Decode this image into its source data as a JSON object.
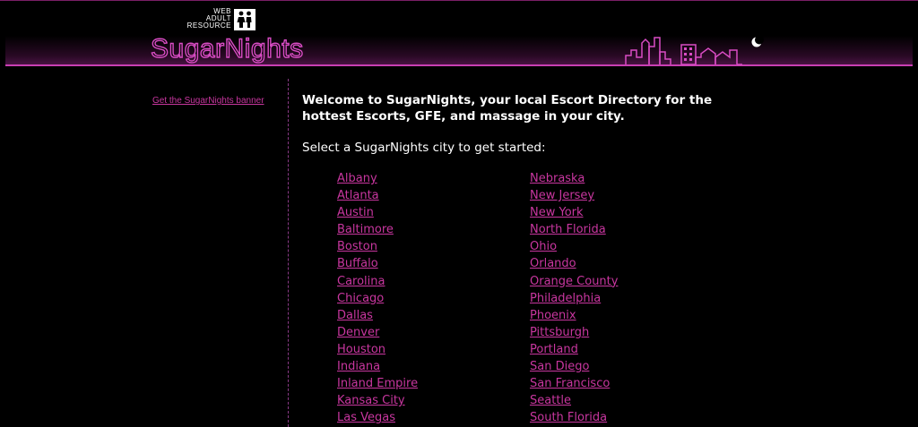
{
  "header": {
    "resource_text": [
      "WEB",
      "ADULT",
      "RESOURCE"
    ],
    "war_icon": "two-people-icon",
    "logo_text": "SugarNights",
    "skyline_icon": "city-skyline-icon",
    "moon_icon": "crescent-moon-icon"
  },
  "sidebar": {
    "banner_link": "Get the SugarNights banner"
  },
  "main": {
    "welcome": "Welcome to SugarNights, your local Escort Directory for the hottest Escorts, GFE, and massage in your city.",
    "select_prompt": "Select a SugarNights city to get started:",
    "cities_left": [
      "Albany",
      "Atlanta",
      "Austin",
      "Baltimore",
      "Boston",
      "Buffalo",
      "Carolina",
      "Chicago",
      "Dallas",
      "Denver",
      "Houston",
      "Indiana",
      "Inland Empire",
      "Kansas City",
      "Las Vegas"
    ],
    "cities_right": [
      "Nebraska",
      "New Jersey",
      "New York",
      "North Florida",
      "Ohio",
      "Orlando",
      "Orange County",
      "Philadelphia",
      "Phoenix",
      "Pittsburgh",
      "Portland",
      "San Diego",
      "San Francisco",
      "Seattle",
      "South Florida"
    ]
  },
  "colors": {
    "background": "#000000",
    "link": "#c8369f",
    "accent": "#c93fb3",
    "text": "#ffffff"
  }
}
